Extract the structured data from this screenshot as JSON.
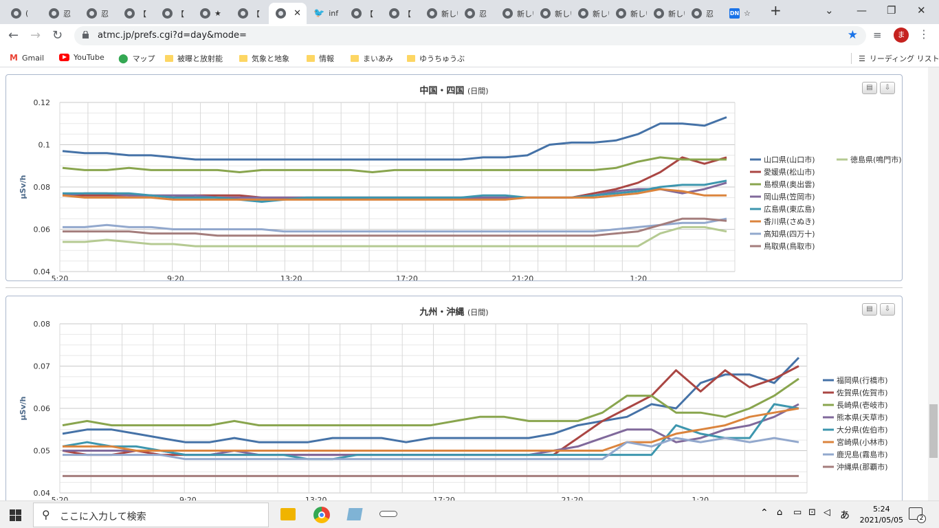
{
  "browser": {
    "tabs": [
      "(",
      "忍",
      "忍",
      "【",
      "【",
      "★",
      "【",
      "",
      "inf",
      "【",
      "【",
      "新しいタ",
      "忍",
      "新しいタ",
      "新しいタ",
      "新しいタ",
      "新しいタ",
      "新しいタ",
      "忍",
      "☆"
    ],
    "active_tab": 7,
    "new_tab": "+",
    "close": "✕",
    "url": "atmc.jp/prefs.cgi?d=day&mode=",
    "profile_initial": "ま",
    "bookmarks": [
      "Gmail",
      "YouTube",
      "マップ",
      "被曝と放射能",
      "気象と地象",
      "情報",
      "まいあみ",
      "ゆうちゅうぶ"
    ],
    "reading_list": "リーディング リスト"
  },
  "taskbar": {
    "search_placeholder": "ここに入力して検索",
    "time": "5:24",
    "date": "2021/05/05",
    "notifications": "2",
    "ime": "あ"
  },
  "chart_data": [
    {
      "type": "line",
      "title": "中国・四国",
      "subtitle": "(日間)",
      "ylabel": "μSv/h",
      "ylim": [
        0.04,
        0.12
      ],
      "yticks": [
        "0.04",
        "0.06",
        "0.08",
        "0.1",
        "0.12"
      ],
      "xticks": [
        "5:20",
        "9:20",
        "13:20",
        "17:20",
        "21:20",
        "1:20"
      ],
      "legend_position": "right",
      "series": [
        {
          "name": "山口県(山口市)",
          "color": "#4572a7",
          "values": [
            0.097,
            0.096,
            0.096,
            0.095,
            0.095,
            0.094,
            0.093,
            0.093,
            0.093,
            0.093,
            0.093,
            0.093,
            0.093,
            0.093,
            0.093,
            0.093,
            0.093,
            0.093,
            0.093,
            0.094,
            0.094,
            0.095,
            0.1,
            0.101,
            0.101,
            0.102,
            0.105,
            0.11,
            0.11,
            0.109,
            0.113
          ]
        },
        {
          "name": "愛媛県(松山市)",
          "color": "#aa4643",
          "values": [
            0.076,
            0.076,
            0.076,
            0.076,
            0.076,
            0.075,
            0.076,
            0.076,
            0.076,
            0.075,
            0.075,
            0.075,
            0.075,
            0.075,
            0.075,
            0.075,
            0.075,
            0.075,
            0.075,
            0.075,
            0.075,
            0.075,
            0.075,
            0.075,
            0.077,
            0.079,
            0.082,
            0.087,
            0.094,
            0.091,
            0.094
          ]
        },
        {
          "name": "島根県(奥出雲)",
          "color": "#89a54e",
          "values": [
            0.089,
            0.088,
            0.088,
            0.089,
            0.088,
            0.088,
            0.088,
            0.088,
            0.087,
            0.088,
            0.088,
            0.088,
            0.088,
            0.088,
            0.087,
            0.088,
            0.088,
            0.088,
            0.088,
            0.088,
            0.088,
            0.088,
            0.088,
            0.088,
            0.088,
            0.089,
            0.092,
            0.094,
            0.093,
            0.093,
            0.093
          ]
        },
        {
          "name": "岡山県(笠岡市)",
          "color": "#80699b",
          "values": [
            0.076,
            0.077,
            0.077,
            0.076,
            0.076,
            0.076,
            0.076,
            0.075,
            0.075,
            0.075,
            0.075,
            0.075,
            0.075,
            0.075,
            0.075,
            0.075,
            0.075,
            0.075,
            0.075,
            0.075,
            0.075,
            0.075,
            0.075,
            0.075,
            0.076,
            0.078,
            0.079,
            0.079,
            0.077,
            0.079,
            0.082
          ]
        },
        {
          "name": "広島県(東広島)",
          "color": "#3d96ae",
          "values": [
            0.077,
            0.077,
            0.077,
            0.077,
            0.076,
            0.075,
            0.075,
            0.075,
            0.074,
            0.073,
            0.074,
            0.075,
            0.075,
            0.075,
            0.075,
            0.075,
            0.075,
            0.075,
            0.075,
            0.076,
            0.076,
            0.075,
            0.075,
            0.075,
            0.076,
            0.077,
            0.078,
            0.08,
            0.081,
            0.081,
            0.083
          ]
        },
        {
          "name": "香川県(さぬき)",
          "color": "#db843d",
          "values": [
            0.076,
            0.075,
            0.075,
            0.075,
            0.075,
            0.074,
            0.074,
            0.074,
            0.074,
            0.074,
            0.074,
            0.074,
            0.074,
            0.074,
            0.074,
            0.074,
            0.074,
            0.074,
            0.074,
            0.074,
            0.074,
            0.075,
            0.075,
            0.075,
            0.075,
            0.076,
            0.077,
            0.079,
            0.078,
            0.076,
            0.076
          ]
        },
        {
          "name": "高知県(四万十)",
          "color": "#92a8cd",
          "values": [
            0.061,
            0.061,
            0.062,
            0.061,
            0.061,
            0.06,
            0.06,
            0.06,
            0.06,
            0.06,
            0.059,
            0.059,
            0.059,
            0.059,
            0.059,
            0.059,
            0.059,
            0.059,
            0.059,
            0.059,
            0.059,
            0.059,
            0.059,
            0.059,
            0.059,
            0.06,
            0.061,
            0.062,
            0.063,
            0.063,
            0.065
          ]
        },
        {
          "name": "鳥取県(鳥取市)",
          "color": "#a47d7c",
          "values": [
            0.059,
            0.059,
            0.059,
            0.059,
            0.058,
            0.058,
            0.058,
            0.057,
            0.057,
            0.057,
            0.057,
            0.057,
            0.057,
            0.057,
            0.057,
            0.057,
            0.057,
            0.057,
            0.057,
            0.057,
            0.057,
            0.057,
            0.057,
            0.057,
            0.057,
            0.058,
            0.059,
            0.062,
            0.065,
            0.065,
            0.064
          ]
        },
        {
          "name": "徳島県(鳴門市)",
          "color": "#b5ca92",
          "values": [
            0.054,
            0.054,
            0.055,
            0.054,
            0.053,
            0.053,
            0.052,
            0.052,
            0.052,
            0.052,
            0.052,
            0.052,
            0.052,
            0.052,
            0.052,
            0.052,
            0.052,
            0.052,
            0.052,
            0.052,
            0.052,
            0.052,
            0.052,
            0.052,
            0.052,
            0.052,
            0.052,
            0.058,
            0.061,
            0.061,
            0.059
          ]
        }
      ]
    },
    {
      "type": "line",
      "title": "九州・沖縄",
      "subtitle": "(日間)",
      "ylabel": "μSv/h",
      "ylim": [
        0.04,
        0.08
      ],
      "yticks": [
        "0.04",
        "0.05",
        "0.06",
        "0.07",
        "0.08"
      ],
      "xticks": [
        "5:20",
        "9:20",
        "13:20",
        "17:20",
        "21:20",
        "1:20"
      ],
      "legend_position": "right",
      "series": [
        {
          "name": "福岡県(行橋市)",
          "color": "#4572a7",
          "values": [
            0.054,
            0.055,
            0.055,
            0.054,
            0.053,
            0.052,
            0.052,
            0.053,
            0.052,
            0.052,
            0.052,
            0.053,
            0.053,
            0.053,
            0.052,
            0.053,
            0.053,
            0.053,
            0.053,
            0.053,
            0.054,
            0.056,
            0.057,
            0.058,
            0.061,
            0.06,
            0.066,
            0.068,
            0.068,
            0.066,
            0.072
          ]
        },
        {
          "name": "佐賀県(佐賀市)",
          "color": "#aa4643",
          "values": [
            0.05,
            0.049,
            0.049,
            0.05,
            0.049,
            0.049,
            0.049,
            0.049,
            0.049,
            0.049,
            0.049,
            0.049,
            0.049,
            0.049,
            0.049,
            0.049,
            0.049,
            0.049,
            0.049,
            0.049,
            0.049,
            0.053,
            0.057,
            0.06,
            0.063,
            0.069,
            0.064,
            0.069,
            0.065,
            0.067,
            0.07
          ]
        },
        {
          "name": "長崎県(壱岐市)",
          "color": "#89a54e",
          "values": [
            0.056,
            0.057,
            0.056,
            0.056,
            0.056,
            0.056,
            0.056,
            0.057,
            0.056,
            0.056,
            0.056,
            0.056,
            0.056,
            0.056,
            0.056,
            0.056,
            0.057,
            0.058,
            0.058,
            0.057,
            0.057,
            0.057,
            0.059,
            0.063,
            0.063,
            0.059,
            0.059,
            0.058,
            0.06,
            0.063,
            0.067
          ]
        },
        {
          "name": "熊本県(天草市)",
          "color": "#80699b",
          "values": [
            0.05,
            0.05,
            0.05,
            0.05,
            0.05,
            0.049,
            0.049,
            0.05,
            0.049,
            0.049,
            0.049,
            0.049,
            0.049,
            0.049,
            0.049,
            0.049,
            0.049,
            0.049,
            0.049,
            0.049,
            0.05,
            0.051,
            0.053,
            0.055,
            0.055,
            0.052,
            0.053,
            0.055,
            0.056,
            0.058,
            0.061
          ]
        },
        {
          "name": "大分県(佐伯市)",
          "color": "#3d96ae",
          "values": [
            0.051,
            0.052,
            0.051,
            0.051,
            0.05,
            0.049,
            0.049,
            0.049,
            0.049,
            0.049,
            0.048,
            0.048,
            0.049,
            0.049,
            0.049,
            0.049,
            0.049,
            0.049,
            0.049,
            0.049,
            0.049,
            0.049,
            0.049,
            0.049,
            0.049,
            0.056,
            0.054,
            0.053,
            0.053,
            0.061,
            0.06
          ]
        },
        {
          "name": "宮崎県(小林市)",
          "color": "#db843d",
          "values": [
            0.051,
            0.051,
            0.051,
            0.05,
            0.05,
            0.05,
            0.05,
            0.05,
            0.05,
            0.05,
            0.05,
            0.05,
            0.05,
            0.05,
            0.05,
            0.05,
            0.05,
            0.05,
            0.05,
            0.05,
            0.05,
            0.05,
            0.05,
            0.052,
            0.052,
            0.054,
            0.055,
            0.056,
            0.058,
            0.059,
            0.06
          ]
        },
        {
          "name": "鹿児島(霧島市)",
          "color": "#92a8cd",
          "values": [
            0.049,
            0.049,
            0.049,
            0.049,
            0.049,
            0.048,
            0.048,
            0.048,
            0.048,
            0.048,
            0.048,
            0.048,
            0.048,
            0.048,
            0.048,
            0.048,
            0.048,
            0.048,
            0.048,
            0.048,
            0.048,
            0.048,
            0.048,
            0.052,
            0.051,
            0.053,
            0.052,
            0.053,
            0.052,
            0.053,
            0.052
          ]
        },
        {
          "name": "沖縄県(那覇市)",
          "color": "#a47d7c",
          "values": [
            0.044,
            0.044,
            0.044,
            0.044,
            0.044,
            0.044,
            0.044,
            0.044,
            0.044,
            0.044,
            0.044,
            0.044,
            0.044,
            0.044,
            0.044,
            0.044,
            0.044,
            0.044,
            0.044,
            0.044,
            0.044,
            0.044,
            0.044,
            0.044,
            0.044,
            0.044,
            0.044,
            0.044,
            0.044,
            0.044,
            0.044
          ]
        }
      ]
    }
  ]
}
